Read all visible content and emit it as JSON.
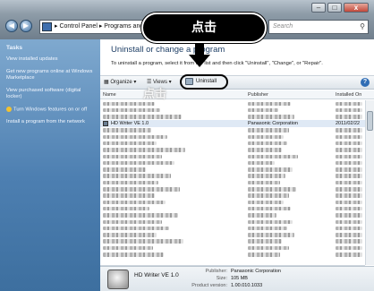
{
  "window": {
    "controls": {
      "minimize": "–",
      "maximize": "□",
      "close": "x"
    },
    "nav": {
      "back": "◀",
      "forward": "▶"
    },
    "address": "▸ Control Panel ▸ Programs and F",
    "search_placeholder": "Search",
    "search_icon": "magnifier-icon"
  },
  "sidebar": {
    "heading": "Tasks",
    "links": [
      "View installed updates",
      "Get new programs online at Windows Marketplace",
      "View purchased software (digital locker)",
      "Turn Windows features on or off",
      "Install a program from the network"
    ]
  },
  "main": {
    "title": "Uninstall or change a program",
    "instructions": "To uninstall a program, select it from the list and then click \"Uninstall\", \"Change\", or \"Repair\".",
    "toolbar": {
      "organize": "Organize ▾",
      "views": "Views ▾",
      "uninstall": "Uninstall",
      "help": "?"
    },
    "columns": {
      "name": "Name",
      "publisher": "Publisher",
      "installed_on": "Installed On"
    },
    "highlighted_row": {
      "name": "HD Writer VE 1.0",
      "publisher": "Panasonic Corporation",
      "installed_on": "2011/02/22"
    }
  },
  "details": {
    "name": "HD Writer VE 1.0",
    "publisher_label": "Publisher:",
    "publisher": "Panasonic Corporation",
    "size_label": "Size:",
    "size": "105 MB",
    "version_label": "Product version:",
    "version": "1.00.010.1033"
  },
  "annotation": {
    "callout_text": "点击",
    "ghost_text": "点击"
  }
}
